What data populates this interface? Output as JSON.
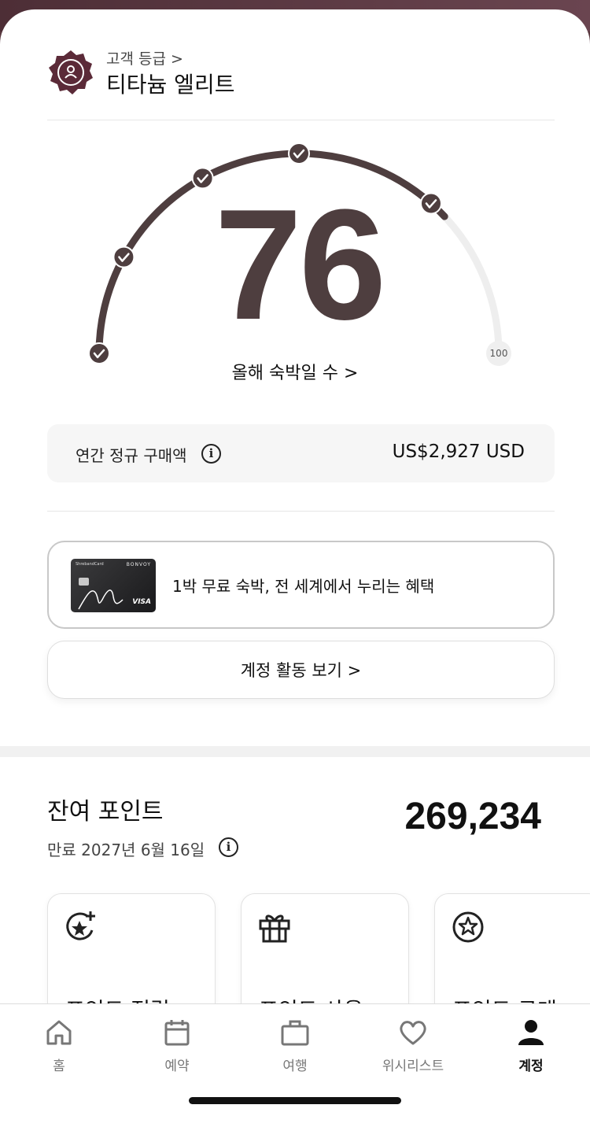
{
  "tier": {
    "label": "고객 등급 >",
    "name": "티타늄 엘리트",
    "badge_color": "#5b2a38"
  },
  "gauge": {
    "value": "76",
    "max_label": "100",
    "value_fraction": 0.76,
    "link_label": "올해 숙박일 수 >",
    "milestones_checked": 5,
    "color_filled": "#4e3e3f",
    "color_track": "#eeeeee"
  },
  "annual_spend": {
    "label": "연간 정규 구매액",
    "info_glyph": "i",
    "value": "US$2,927 USD"
  },
  "card_promo": {
    "text": "1박 무료 숙박, 전 세계에서 누리는 혜택",
    "card_brand_left": "ShrebandCard",
    "card_brand_right": "BONVOY",
    "card_network": "VISA"
  },
  "activity_button": {
    "label": "계정 활동 보기 >"
  },
  "points": {
    "title": "잔여 포인트",
    "value": "269,234",
    "expiry": "만료 2027년 6월 16일",
    "info_glyph": "i",
    "tiles": [
      {
        "label": "포인트 적립",
        "icon": "star-plus-icon"
      },
      {
        "label": "포인트 사용",
        "icon": "gift-icon"
      },
      {
        "label": "포인트 구매",
        "icon": "star-circle-icon"
      }
    ],
    "accent_color": "#f08a5d"
  },
  "tabbar": {
    "tabs": [
      {
        "label": "홈",
        "icon": "home-icon"
      },
      {
        "label": "예약",
        "icon": "calendar-icon"
      },
      {
        "label": "여행",
        "icon": "suitcase-icon"
      },
      {
        "label": "위시리스트",
        "icon": "heart-icon"
      },
      {
        "label": "계정",
        "icon": "person-icon",
        "active": true
      }
    ]
  }
}
